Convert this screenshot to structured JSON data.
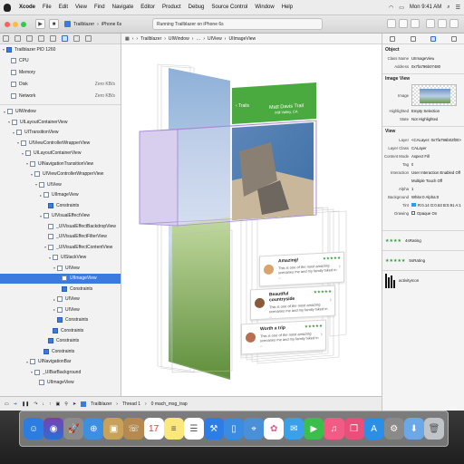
{
  "menubar": {
    "items": [
      "Xcode",
      "File",
      "Edit",
      "View",
      "Find",
      "Navigate",
      "Editor",
      "Product",
      "Debug",
      "Source Control",
      "Window",
      "Help"
    ],
    "clock": "Mon 9:41 AM"
  },
  "toolbar": {
    "scheme": "Trailblazer",
    "device": "iPhone 6s",
    "status": "Running Trailblazer on iPhone 6s"
  },
  "navigator": {
    "project": "Trailblazer PID 1260",
    "gauges": [
      {
        "label": "CPU",
        "value": ""
      },
      {
        "label": "Memory",
        "value": ""
      },
      {
        "label": "Disk",
        "value": "Zero KB/s"
      },
      {
        "label": "Network",
        "value": "Zero KB/s"
      }
    ],
    "tree": [
      {
        "label": "UIWindow",
        "indent": 0,
        "icon": "view",
        "tri": "▾"
      },
      {
        "label": "UILayoutContainerView",
        "indent": 1,
        "icon": "view",
        "tri": "▾"
      },
      {
        "label": "UITransitionView",
        "indent": 2,
        "icon": "view",
        "tri": "▾"
      },
      {
        "label": "UIViewControllerWrapperView",
        "indent": 3,
        "icon": "view",
        "tri": "▾"
      },
      {
        "label": "UILayoutContainerView",
        "indent": 4,
        "icon": "view",
        "tri": "▾"
      },
      {
        "label": "UINavigationTransitionView",
        "indent": 5,
        "icon": "view",
        "tri": "▾"
      },
      {
        "label": "UIViewControllerWrapperView",
        "indent": 6,
        "icon": "view",
        "tri": "▾"
      },
      {
        "label": "UIView",
        "indent": 7,
        "icon": "view",
        "tri": "▾"
      },
      {
        "label": "UIImageView",
        "indent": 8,
        "icon": "view",
        "tri": "▸"
      },
      {
        "label": "Constraints",
        "indent": 9,
        "icon": "blue",
        "tri": ""
      },
      {
        "label": "UIVisualEffectView",
        "indent": 8,
        "icon": "view",
        "tri": "▾"
      },
      {
        "label": "_UIVisualEffectBackdropView",
        "indent": 9,
        "icon": "view",
        "tri": ""
      },
      {
        "label": "_UIVisualEffectFilterView",
        "indent": 9,
        "icon": "view",
        "tri": ""
      },
      {
        "label": "_UIVisualEffectContentView",
        "indent": 9,
        "icon": "view",
        "tri": "▾"
      },
      {
        "label": "UIStackView",
        "indent": 10,
        "icon": "view",
        "tri": "▾"
      },
      {
        "label": "UIView",
        "indent": 11,
        "icon": "view",
        "tri": "▾"
      },
      {
        "label": "UIImageView",
        "indent": 12,
        "icon": "view",
        "tri": "",
        "selected": true
      },
      {
        "label": "Constraints",
        "indent": 12,
        "icon": "blue",
        "tri": ""
      },
      {
        "label": "UIView",
        "indent": 11,
        "icon": "view",
        "tri": "▸"
      },
      {
        "label": "UIView",
        "indent": 11,
        "icon": "view",
        "tri": "▸"
      },
      {
        "label": "Constraints",
        "indent": 11,
        "icon": "blue",
        "tri": ""
      },
      {
        "label": "Constraints",
        "indent": 10,
        "icon": "blue",
        "tri": ""
      },
      {
        "label": "Constraints",
        "indent": 9,
        "icon": "blue",
        "tri": ""
      },
      {
        "label": "Constraints",
        "indent": 8,
        "icon": "blue",
        "tri": ""
      },
      {
        "label": "UINavigationBar",
        "indent": 5,
        "icon": "view",
        "tri": "▾"
      },
      {
        "label": "_UIBarBackground",
        "indent": 6,
        "icon": "view",
        "tri": "▾"
      },
      {
        "label": "UIImageView",
        "indent": 7,
        "icon": "view",
        "tri": ""
      }
    ]
  },
  "jumpbar": {
    "crumbs": [
      "Trailblazer",
      "UIWindow",
      "UILayoutContainerView",
      "UITransitionView",
      "UIViewControllerWrapperView",
      "UILayoutContainerView",
      "UIView",
      "UIImageView"
    ]
  },
  "canvas": {
    "nav_title": "Matt Davis Trail",
    "nav_subtitle": "Mill Valley, CA",
    "back_label": "Trails",
    "cards": [
      {
        "title": "Amazing!",
        "text": "This is one of the most amazing scenaries me and my family hiked in ..."
      },
      {
        "title": "Beautiful countryside",
        "text": "This is one of the most amazing scenaries me and my family hiked in ..."
      },
      {
        "title": "Worth a trip",
        "text": "This is one of the most amazing scenaries me and my family hiked in ..."
      }
    ],
    "stars": "★★★★★"
  },
  "inspector": {
    "object_section": "Object",
    "class_name_label": "Class Name",
    "class_name": "UIImageView",
    "address_label": "Address",
    "address": "0x7fa796b07480",
    "image_section": "Image View",
    "image_label": "Image",
    "highlighted_label": "Highlighted",
    "highlighted": "Empty Selection",
    "state_label": "State",
    "state": "Not Highlighted",
    "view_section": "View",
    "layer_label": "Layer",
    "layer": "<CALayer: 0x7fa796b02f00>",
    "layer_class_label": "Layer Class",
    "layer_class": "CALayer",
    "content_mode_label": "Content Mode",
    "content_mode": "Aspect Fill",
    "tag_label": "Tag",
    "tag": "0",
    "interaction_label": "Interaction",
    "interaction": "User Interaction Enabled Off",
    "multiple_touch": "Multiple Touch Off",
    "alpha_label": "Alpha",
    "alpha": "1",
    "background_label": "Background",
    "background": "White:0 Alpha:0",
    "tint_label": "Tint",
    "tint": "R:0.14 G:0.63 B:0.91 A:1",
    "drawing_label": "Drawing",
    "drawing": "Opaque On",
    "list": [
      {
        "stars": "★★★★",
        "label": "4sRating"
      },
      {
        "stars": "★★★★★",
        "label": "5sRating"
      },
      {
        "stars": "",
        "label": "activityIcon"
      }
    ]
  },
  "debugbar": {
    "target": "Trailblazer",
    "thread": "Thread 1",
    "frame": "0 mach_msg_trap"
  },
  "colors": {
    "selection": "#3b7be0",
    "navbar_green": "#4aaa3f",
    "highlight_purple": "#b7a0d8",
    "star_green": "#2f9b3a"
  }
}
